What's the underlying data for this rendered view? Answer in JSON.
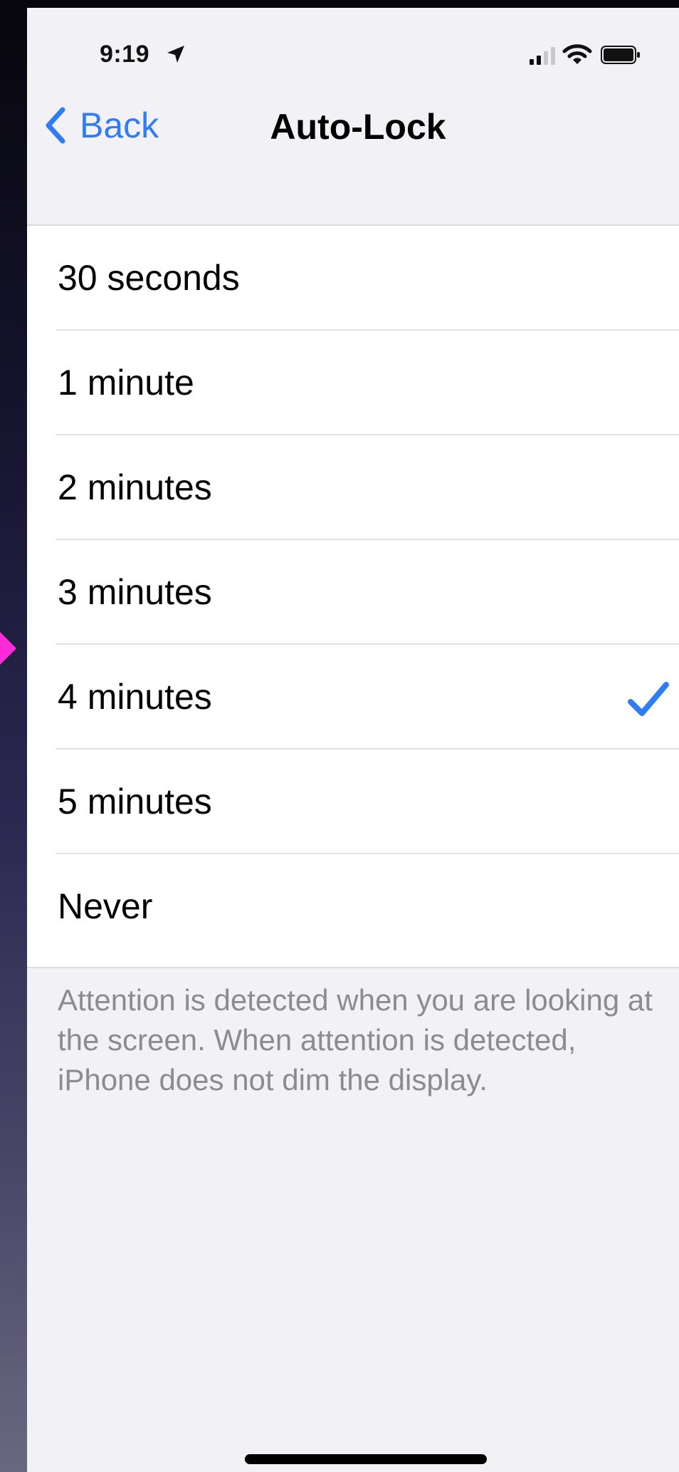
{
  "status_bar": {
    "time": "9:19",
    "icons": [
      "location-arrow-icon",
      "cellular-signal-icon",
      "wifi-icon",
      "battery-icon"
    ]
  },
  "nav": {
    "back_label": "Back",
    "title": "Auto-Lock"
  },
  "options": [
    {
      "label": "30 seconds",
      "selected": false
    },
    {
      "label": "1 minute",
      "selected": false
    },
    {
      "label": "2 minutes",
      "selected": false
    },
    {
      "label": "3 minutes",
      "selected": false
    },
    {
      "label": "4 minutes",
      "selected": true
    },
    {
      "label": "5 minutes",
      "selected": false
    },
    {
      "label": "Never",
      "selected": false
    }
  ],
  "footer": {
    "note": "Attention is detected when you are looking at the screen. When attention is detected, iPhone does not dim the display."
  },
  "colors": {
    "accent": "#2f7cf6",
    "background": "#f1f1f6",
    "list_background": "#ffffff",
    "annotation_arrow": "#ff2ad8"
  }
}
